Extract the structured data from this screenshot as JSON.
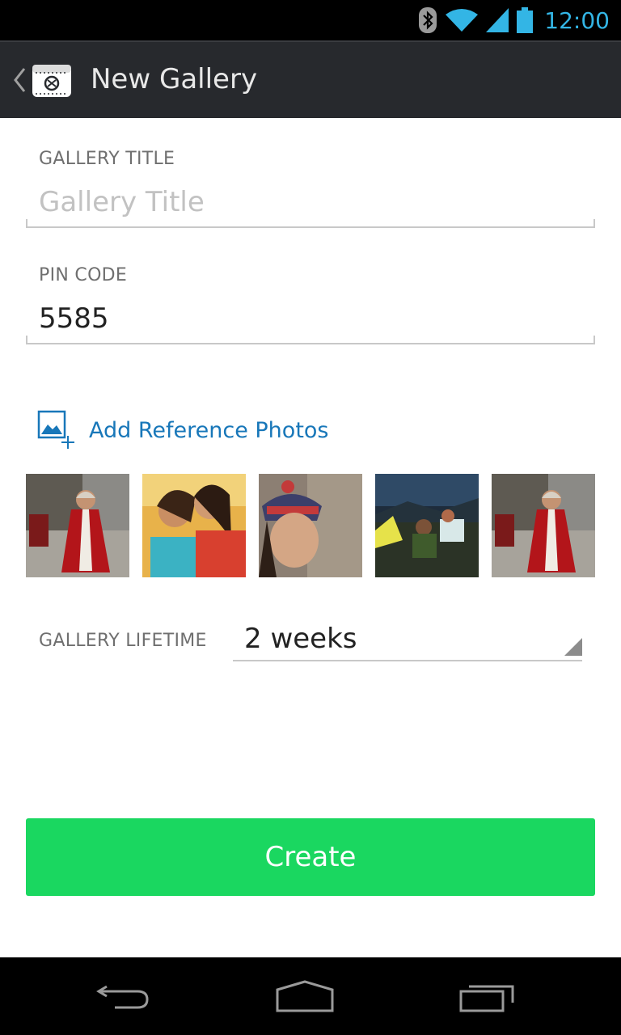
{
  "status_bar": {
    "time": "12:00",
    "icons": [
      "bluetooth-icon",
      "wifi-icon",
      "signal-icon",
      "battery-icon"
    ],
    "accent_color": "#33b5e5"
  },
  "action_bar": {
    "title": "New Gallery",
    "icons": [
      "up-caret-icon",
      "gallery-app-icon"
    ]
  },
  "form": {
    "gallery_title": {
      "label": "GALLERY TITLE",
      "placeholder": "Gallery Title",
      "value": ""
    },
    "pin_code": {
      "label": "PIN CODE",
      "value": "5585"
    },
    "add_photos": {
      "label": "Add Reference Photos",
      "icon": "add-image-icon",
      "color": "#1877b9"
    },
    "reference_photos": [
      {
        "name": "photo-man-in-red-robe"
      },
      {
        "name": "photo-two-women-smiling"
      },
      {
        "name": "photo-woman-in-beanie"
      },
      {
        "name": "photo-people-with-tent-at-night"
      },
      {
        "name": "photo-man-in-red-robe"
      }
    ],
    "gallery_lifetime": {
      "label": "GALLERY LIFETIME",
      "value": "2 weeks"
    },
    "create_button": {
      "label": "Create",
      "color": "#1ad760"
    }
  },
  "nav_bar": {
    "buttons": [
      "back-icon",
      "home-icon",
      "recent-apps-icon"
    ]
  }
}
